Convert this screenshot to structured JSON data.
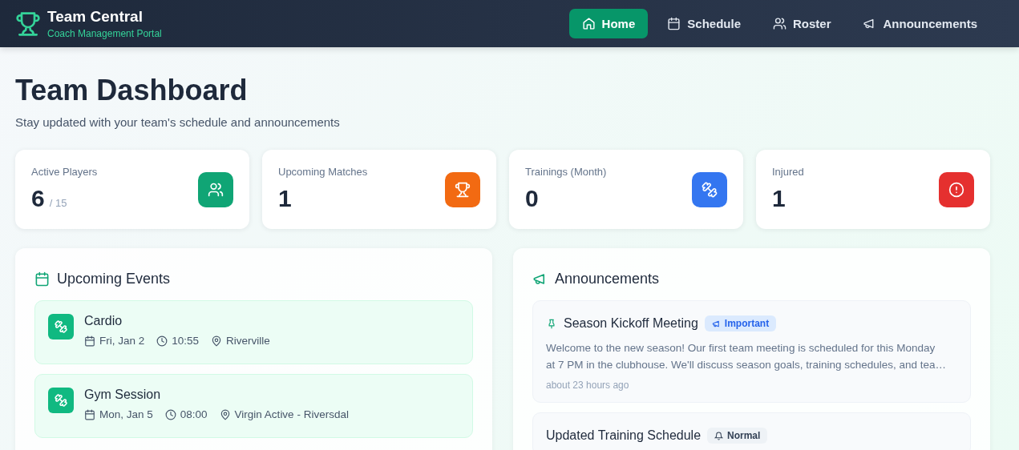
{
  "header": {
    "title": "Team Central",
    "subtitle": "Coach Management Portal"
  },
  "nav": [
    {
      "label": "Home",
      "kind": "home",
      "selected": true
    },
    {
      "label": "Schedule",
      "kind": "calendar",
      "selected": false
    },
    {
      "label": "Roster",
      "kind": "people",
      "selected": false
    },
    {
      "label": "Announcements",
      "kind": "megaphone",
      "selected": false
    }
  ],
  "page": {
    "title": "Team Dashboard",
    "subtitle": "Stay updated with your team's schedule and announcements"
  },
  "stats": [
    {
      "label": "Active Players",
      "value": "6",
      "total": "/ 15",
      "kind": "people",
      "color": "#10a575"
    },
    {
      "label": "Upcoming Matches",
      "value": "1",
      "kind": "trophy",
      "color": "#f26a12"
    },
    {
      "label": "Trainings (Month)",
      "value": "0",
      "kind": "dumbbell",
      "color": "#3476f0"
    },
    {
      "label": "Injured",
      "value": "1",
      "kind": "alert",
      "color": "#e5302f"
    }
  ],
  "events": {
    "title": "Upcoming Events",
    "items": [
      {
        "name": "Cardio",
        "date": "Fri, Jan 2",
        "time": "10:55",
        "location": "Riverville"
      },
      {
        "name": "Gym Session",
        "date": "Mon, Jan 5",
        "time": "08:00",
        "location": "Virgin Active - Riversdal"
      }
    ]
  },
  "announcements": {
    "title": "Announcements",
    "items": [
      {
        "title": "Season Kickoff Meeting",
        "pinned": true,
        "kind": "important",
        "badge": "Important",
        "body": "Welcome to the new season! Our first team meeting is scheduled for this Monday at 7 PM in the clubhouse. We'll discuss season goals, training schedules, and tea…",
        "time": "about 23 hours ago"
      },
      {
        "title": "Updated Training Schedule",
        "pinned": false,
        "kind": "normal",
        "badge": "Normal"
      }
    ]
  }
}
